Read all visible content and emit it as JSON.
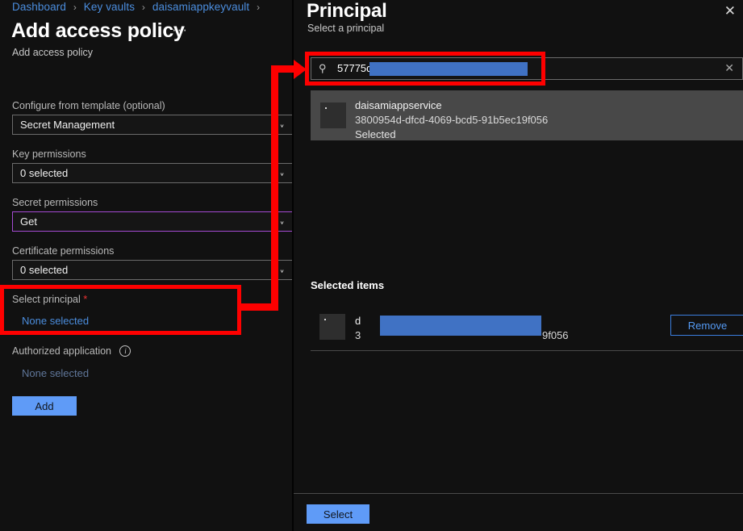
{
  "left": {
    "breadcrumb": [
      {
        "label": "Dashboard"
      },
      {
        "label": "Key vaults"
      },
      {
        "label": "daisamiappkeyvault"
      }
    ],
    "breadcrumb_separator": "›",
    "title": "Add access policy",
    "title_overflow": "···",
    "subtitle": "Add access policy",
    "fields": [
      {
        "label": "Configure from template (optional)",
        "value": "Secret Management",
        "chevron": "⌄",
        "focused": false
      },
      {
        "label": "Key permissions",
        "value": "0 selected",
        "chevron": "⌄",
        "focused": false
      },
      {
        "label": "Secret permissions",
        "value": "Get",
        "chevron": "⌄",
        "focused": true
      },
      {
        "label": "Certificate permissions",
        "value": "0 selected",
        "chevron": "⌄",
        "focused": false
      }
    ],
    "select_principal": {
      "label": "Select principal",
      "required_marker": "*",
      "value": "None selected"
    },
    "authorized_application": {
      "label": "Authorized application",
      "info_glyph": "i",
      "value": "None selected"
    },
    "add_button": "Add"
  },
  "right": {
    "title": "Principal",
    "subtitle": "Select a principal",
    "close_glyph": "✕",
    "search": {
      "icon_glyph": "⚲",
      "value": "57775dc",
      "clear_glyph": "✕",
      "redacted": true
    },
    "results": [
      {
        "name": "daisamiappservice",
        "id": "3800954d-dfcd-4069-bcd5-91b5ec19f056",
        "state": "Selected",
        "icon": "app-service-icon"
      }
    ],
    "selected_items_heading": "Selected items",
    "selected_items": [
      {
        "name_prefix": "d",
        "id_prefix": "3",
        "id_suffix": "9f056",
        "icon": "app-service-icon",
        "remove_label": "Remove",
        "redacted": true
      }
    ],
    "select_button": "Select"
  },
  "annotations": {
    "color": "#fe0000",
    "highlight_search_box": true,
    "highlight_select_principal": true,
    "arrow_from_select_principal_to_search": true
  },
  "colors": {
    "accent_blue": "#5f9bf7",
    "link_blue": "#4b8ddd",
    "focus_purple": "#a44ad3",
    "annotation_red": "#fe0000",
    "redaction_blue": "#4072c4",
    "panel_bg": "#111111",
    "row_selected_bg": "#484848"
  }
}
